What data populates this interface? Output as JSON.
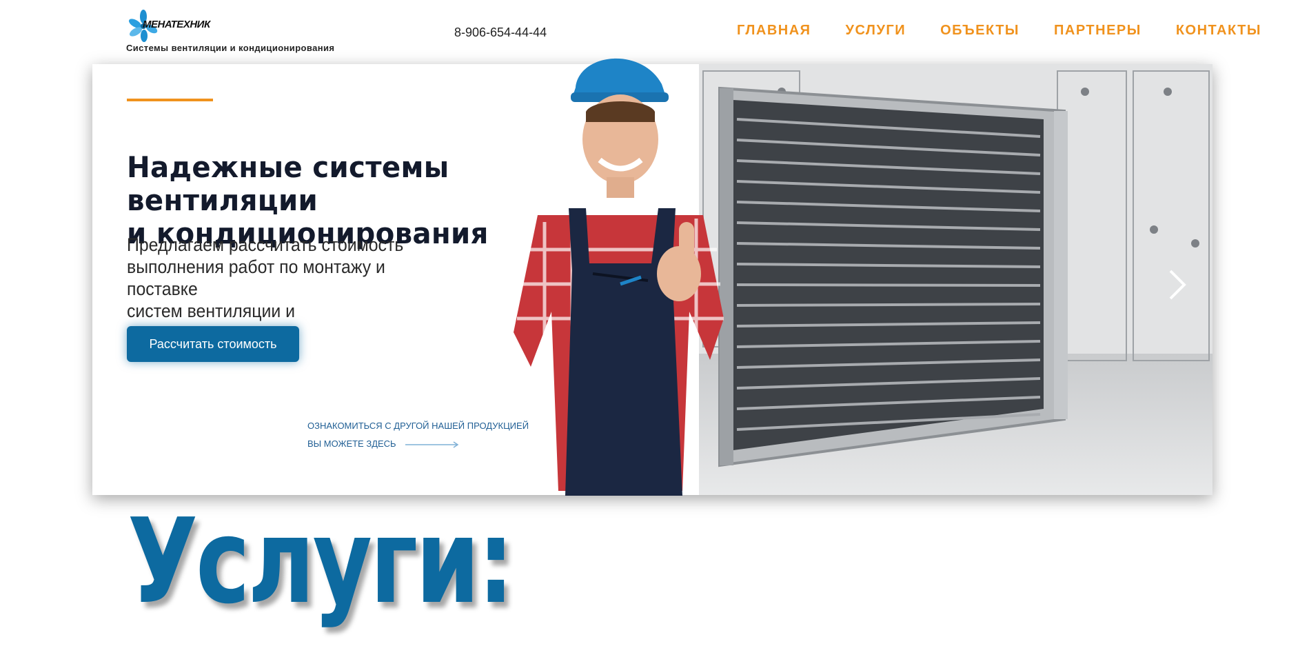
{
  "header": {
    "logo_text": "МЕНАТЕХНИК",
    "tagline": "Системы вентиляции и кондиционирования",
    "phone": "8-906-654-44-44",
    "nav": [
      {
        "label": "ГЛАВНАЯ"
      },
      {
        "label": "УСЛУГИ"
      },
      {
        "label": "ОБЪЕКТЫ"
      },
      {
        "label": "ПАРТНЕРЫ"
      },
      {
        "label": "КОНТАКТЫ"
      }
    ]
  },
  "hero": {
    "title_line1": "Надежные системы вентиляции",
    "title_line2": "и кондиционирования",
    "subtitle_line1": "Предлагаем рассчитать стоимость",
    "subtitle_line2": "выполнения работ по монтажу и поставке",
    "subtitle_line3": "систем вентиляции и кондиционирования.",
    "cta_label": "Рассчитать стоимость",
    "more_line1": "ОЗНАКОМИТЬСЯ С ДРУГОЙ НАШЕЙ ПРОДУКЦИЕЙ",
    "more_line2": "ВЫ МОЖЕТЕ ЗДЕСЬ"
  },
  "services": {
    "title": "Услуги:"
  },
  "colors": {
    "accent": "#f0921d",
    "brand_blue": "#0d6aa0",
    "title_dark": "#131a2c"
  }
}
